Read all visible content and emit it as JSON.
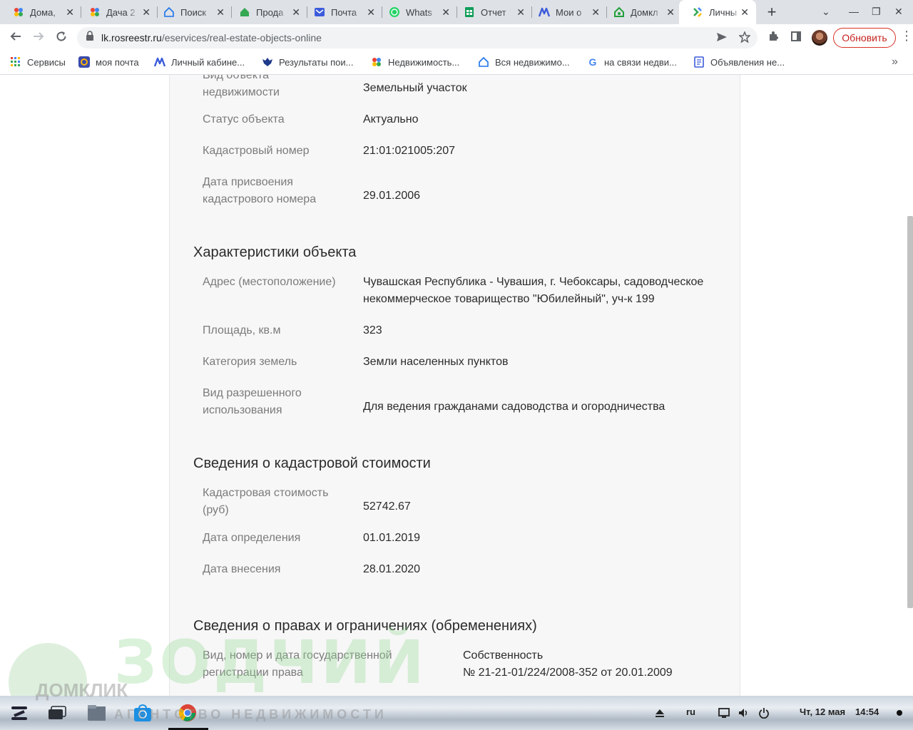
{
  "browser": {
    "tabs": [
      {
        "title": "Дома,",
        "icon": "dots-icon"
      },
      {
        "title": "Дача 2",
        "icon": "dots-icon"
      },
      {
        "title": "Поиск",
        "icon": "house-icon"
      },
      {
        "title": "Прода",
        "icon": "house-green-icon"
      },
      {
        "title": "Почта",
        "icon": "mail-icon"
      },
      {
        "title": "Whats",
        "icon": "whatsapp-icon"
      },
      {
        "title": "Отчет",
        "icon": "sheets-icon"
      },
      {
        "title": "Мои о",
        "icon": "m-icon"
      },
      {
        "title": "Домкл",
        "icon": "domclick-icon"
      },
      {
        "title": "Личны",
        "icon": "rosreestr-icon",
        "active": true
      }
    ],
    "new_tab": "+",
    "close_glyph": "✕",
    "url_domain": "lk.rosreestr.ru",
    "url_path": "/eservices/real-estate-objects-online",
    "update_button": "Обновить",
    "bookmarks": [
      {
        "label": "Сервисы",
        "icon": "apps-grid-icon"
      },
      {
        "label": "моя почта",
        "icon": "mail-at-icon"
      },
      {
        "label": "Личный кабине...",
        "icon": "m-icon"
      },
      {
        "label": "Результаты пои...",
        "icon": "emblem-icon"
      },
      {
        "label": "Недвижимость...",
        "icon": "dots-icon"
      },
      {
        "label": "Вся недвижимо...",
        "icon": "house-icon"
      },
      {
        "label": "на связи недви...",
        "icon": "google-icon"
      },
      {
        "label": "Объявления не...",
        "icon": "doc-icon"
      }
    ]
  },
  "content": {
    "rows_top": [
      {
        "label": "Вид объекта недвижимости",
        "value": "Земельный участок"
      },
      {
        "label": "Статус объекта",
        "value": "Актуально"
      },
      {
        "label": "Кадастровый номер",
        "value": "21:01:021005:207"
      },
      {
        "label": "Дата присвоения кадастрового номера",
        "value": "29.01.2006"
      }
    ],
    "section_characteristics": "Характеристики объекта",
    "rows_characteristics": [
      {
        "label": "Адрес (местоположение)",
        "value": "Чувашская Республика - Чувашия, г. Чебоксары, садоводческое некоммерческое товарищество \"Юбилейный\", уч-к 199"
      },
      {
        "label": "Площадь, кв.м",
        "value": "323"
      },
      {
        "label": "Категория земель",
        "value": "Земли населенных пунктов"
      },
      {
        "label": "Вид разрешенного использования",
        "value": "Для ведения гражданами садоводства и огородничества"
      }
    ],
    "section_cost": "Сведения о кадастровой стоимости",
    "rows_cost": [
      {
        "label": "Кадастровая стоимость (руб)",
        "value": "52742.67"
      },
      {
        "label": "Дата определения",
        "value": "01.01.2019"
      },
      {
        "label": "Дата внесения",
        "value": "28.01.2020"
      }
    ],
    "section_rights": "Сведения о правах и ограничениях (обременениях)",
    "rights": {
      "label": "Вид, номер и дата государственной регистрации права",
      "value_line1": "Собственность",
      "value_line2": "№ 21-21-01/224/2008-352 от 20.01.2009"
    }
  },
  "watermark": {
    "text": "ЗОДЧИЙ",
    "subtitle": "АГЕНТСТВО НЕДВИЖИМОСТИ",
    "logo_text": "ДОМКЛИК"
  },
  "taskbar": {
    "language": "ru",
    "date": "Чт, 12 мая",
    "time": "14:54"
  }
}
